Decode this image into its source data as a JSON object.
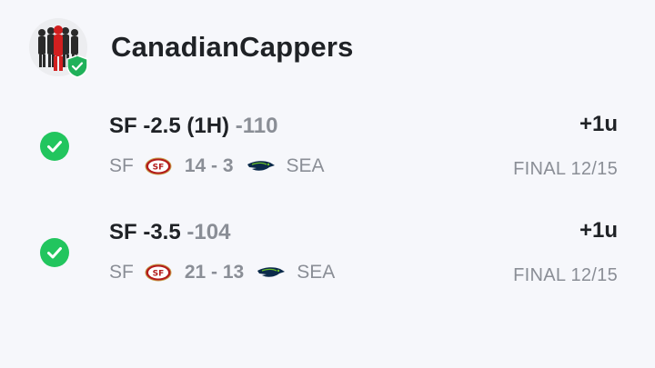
{
  "header": {
    "handle": "CanadianCappers",
    "avatar_icon": "group-silhouette-avatar",
    "verified_icon": "verified-shield-icon"
  },
  "colors": {
    "win_green": "#22c55e",
    "badge_green": "#20b15a",
    "niners_red": "#b31b1b",
    "seahawks_navy": "#0b2a4a",
    "seahawks_green": "#69be28",
    "muted": "#8a8e96"
  },
  "picks": [
    {
      "status_icon": "check-circle-icon",
      "selection": "SF -2.5 (1H)",
      "odds": "-110",
      "result": "+1u",
      "away_team": "SF",
      "score": "14 - 3",
      "home_team": "SEA",
      "final": "FINAL 12/15"
    },
    {
      "status_icon": "check-circle-icon",
      "selection": "SF -3.5",
      "odds": "-104",
      "result": "+1u",
      "away_team": "SF",
      "score": "21 - 13",
      "home_team": "SEA",
      "final": "FINAL 12/15"
    }
  ]
}
